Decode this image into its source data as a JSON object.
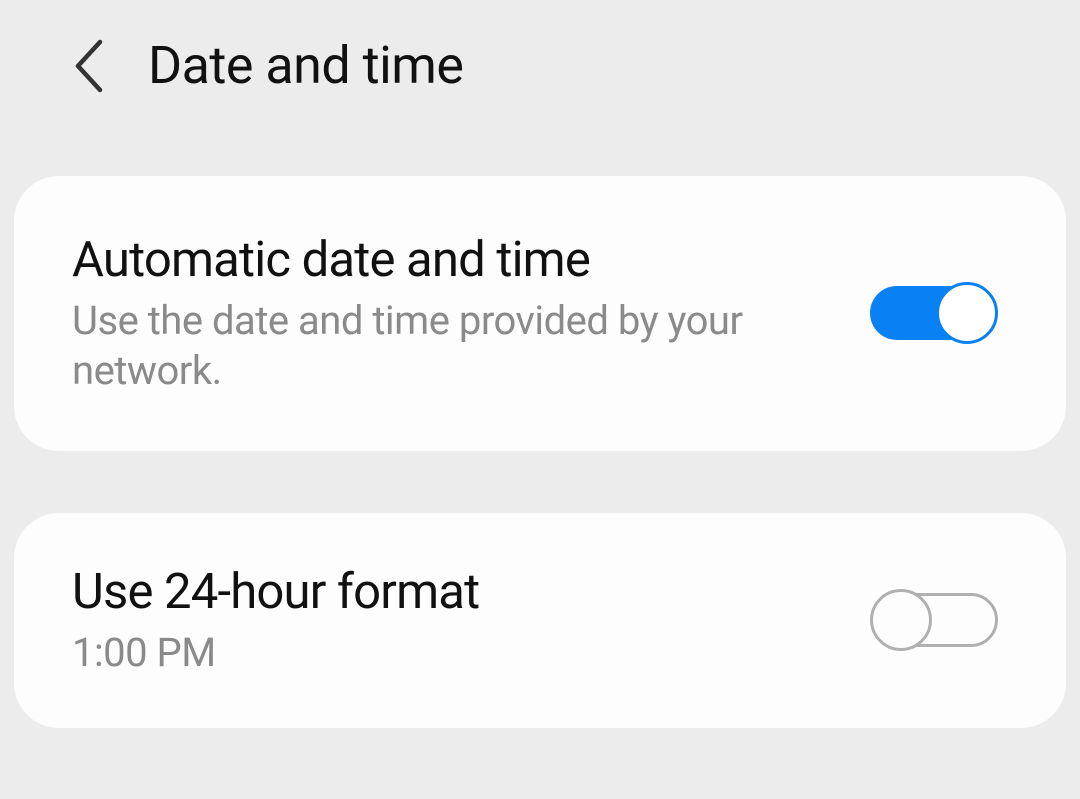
{
  "header": {
    "title": "Date and time"
  },
  "settings": {
    "automatic": {
      "title": "Automatic date and time",
      "subtitle": "Use the date and time provided by your network.",
      "enabled": true
    },
    "format24h": {
      "title": "Use 24-hour format",
      "subtitle": "1:00 PM",
      "enabled": false
    }
  }
}
